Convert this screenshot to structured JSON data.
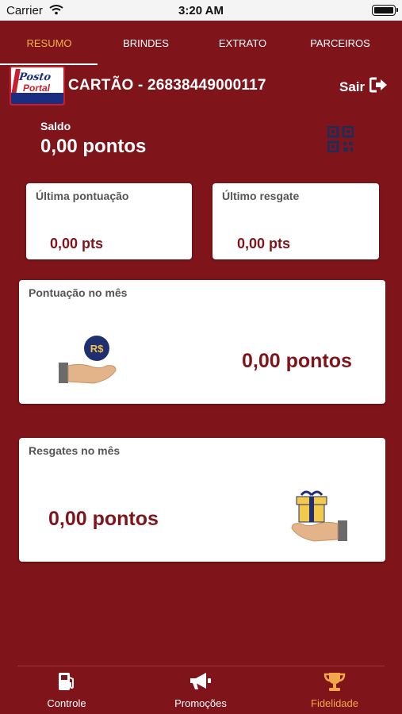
{
  "status_bar": {
    "carrier": "Carrier",
    "time": "3:20 AM"
  },
  "tabs": [
    {
      "label": "RESUMO",
      "active": true
    },
    {
      "label": "BRINDES",
      "active": false
    },
    {
      "label": "EXTRATO",
      "active": false
    },
    {
      "label": "PARCEIROS",
      "active": false
    }
  ],
  "header": {
    "card_title": "CARTÃO - 26838449000117",
    "logout_label": "Sair",
    "logo_text_1": "Posto",
    "logo_text_2": "Portal"
  },
  "balance": {
    "label": "Saldo",
    "value": "0,00 pontos"
  },
  "summary": {
    "last_points_title": "Última pontuação",
    "last_points_value": "0,00 pts",
    "last_redeem_title": "Último resgate",
    "last_redeem_value": "0,00 pts"
  },
  "monthly_points": {
    "title": "Pontuação no mês",
    "value": "0,00 pontos",
    "coin_label": "R$"
  },
  "monthly_redeems": {
    "title": "Resgates no mês",
    "value": "0,00 pontos"
  },
  "bottom_nav": [
    {
      "label": "Controle",
      "icon": "fuel-pump-icon",
      "active": false
    },
    {
      "label": "Promoções",
      "icon": "megaphone-icon",
      "active": false
    },
    {
      "label": "Fidelidade",
      "icon": "trophy-icon",
      "active": true
    }
  ],
  "colors": {
    "background": "#7f151b",
    "accent": "#f3b04c",
    "value_text": "#7f151b"
  }
}
